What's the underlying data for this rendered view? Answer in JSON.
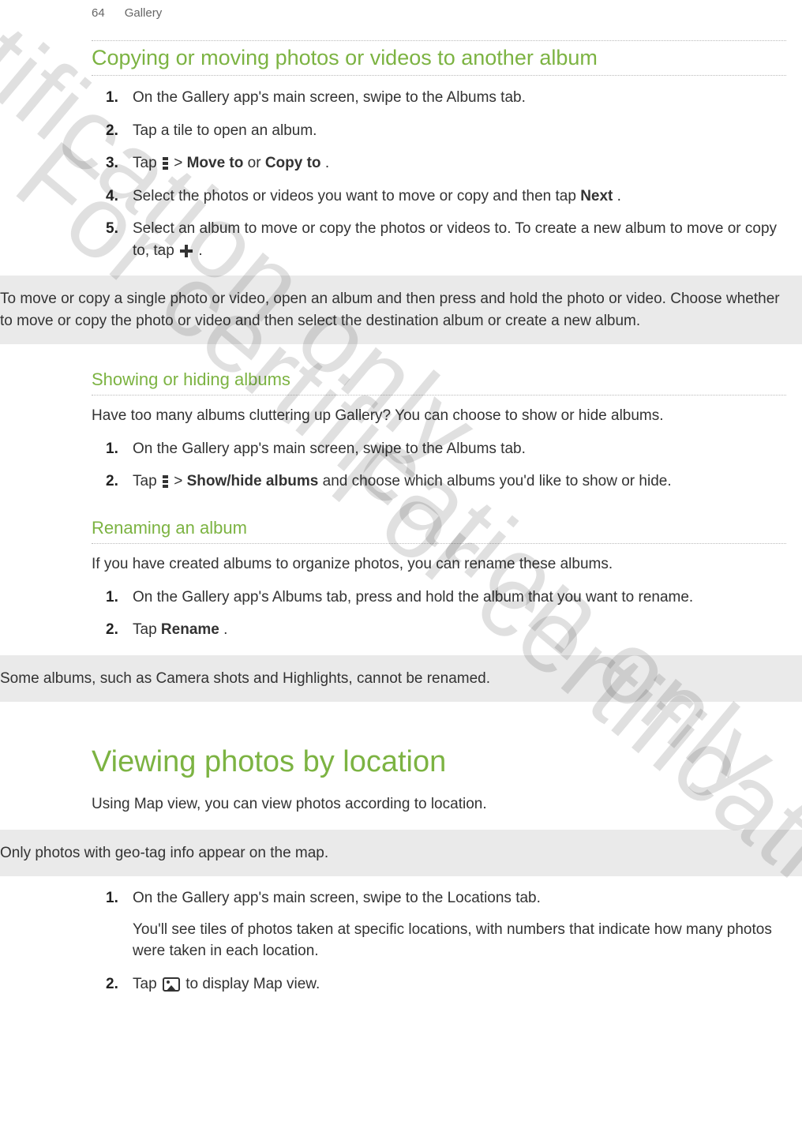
{
  "page": {
    "num": "64",
    "section": "Gallery"
  },
  "watermarks": {
    "text": "For certification only"
  },
  "s1": {
    "title": "Copying or moving photos or videos to another album",
    "steps": [
      "On the Gallery app's main screen, swipe to the Albums tab.",
      "Tap a tile to open an album.",
      {
        "pre": "Tap ",
        "mid": " > ",
        "b1": "Move to",
        "or": " or ",
        "b2": "Copy to",
        "post": "."
      },
      {
        "pre": "Select the photos or videos you want to move or copy and then tap ",
        "b1": "Next",
        "post": "."
      },
      {
        "pre": "Select an album to move or copy the photos or videos to. To create a new album to move or copy to, tap ",
        "post": "."
      }
    ],
    "note": "To move or copy a single photo or video, open an album and then press and hold the photo or video. Choose whether to move or copy the photo or video and then select the destination album or create a new album."
  },
  "s2": {
    "title": "Showing or hiding albums",
    "intro": "Have too many albums cluttering up Gallery? You can choose to show or hide albums.",
    "steps": [
      "On the Gallery app's main screen, swipe to the Albums tab.",
      {
        "pre": "Tap ",
        "mid": " > ",
        "b1": "Show/hide albums",
        "post": " and choose which albums you'd like to show or hide."
      }
    ]
  },
  "s3": {
    "title": "Renaming an album",
    "intro": "If you have created albums to organize photos, you can rename these albums.",
    "steps": [
      "On the Gallery app's Albums tab, press and hold the album that you want to rename.",
      {
        "pre": "Tap ",
        "b1": "Rename",
        "post": "."
      }
    ],
    "note": "Some albums, such as Camera shots and Highlights, cannot be renamed."
  },
  "s4": {
    "title": "Viewing photos by location",
    "intro": "Using Map view, you can view photos according to location.",
    "note": "Only photos with geo-tag info appear on the map.",
    "steps": [
      {
        "a": "On the Gallery app's main screen, swipe to the Locations tab.",
        "b": "You'll see tiles of photos taken at specific locations, with numbers that indicate how many photos were taken in each location."
      },
      {
        "pre": "Tap ",
        "post": " to display Map view."
      }
    ]
  }
}
